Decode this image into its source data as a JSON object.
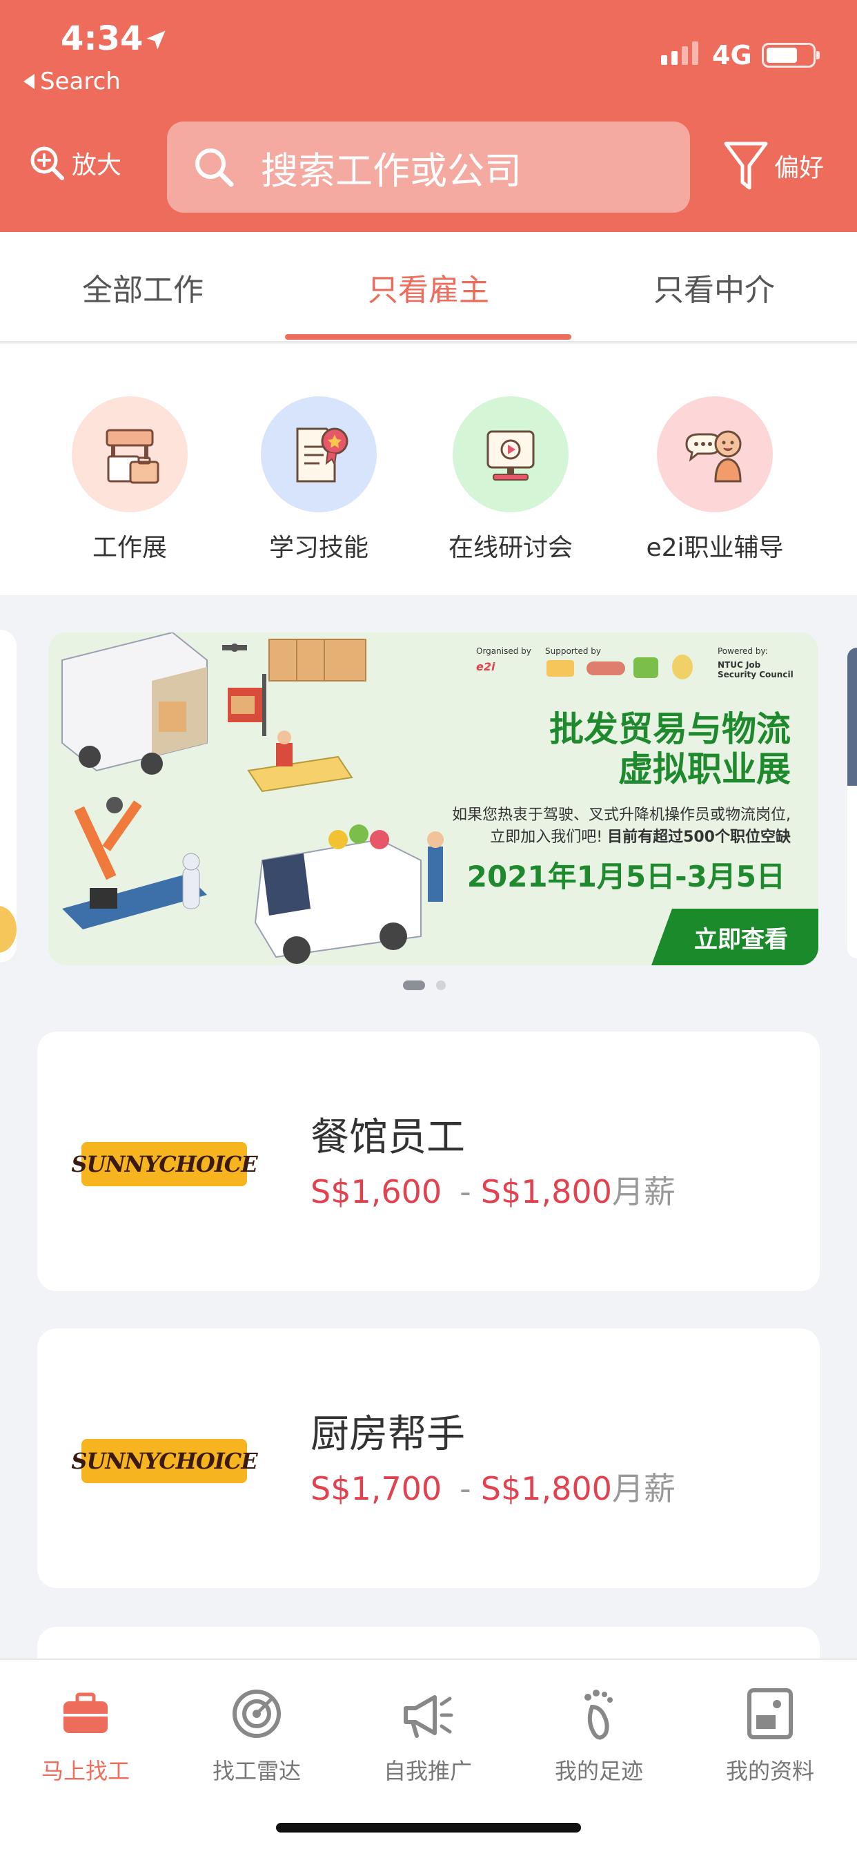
{
  "status_bar": {
    "time": "4:34",
    "back_label": "Search",
    "network": "4G"
  },
  "header": {
    "zoom_label": "放大",
    "search_placeholder": "搜索工作或公司",
    "preference_label": "偏好",
    "accent_color": "#ee6c5c"
  },
  "tabs": [
    {
      "label": "全部工作",
      "active": false
    },
    {
      "label": "只看雇主",
      "active": true
    },
    {
      "label": "只看中介",
      "active": false
    }
  ],
  "categories": [
    {
      "label": "工作展",
      "icon": "job-fair-icon"
    },
    {
      "label": "学习技能",
      "icon": "learn-skill-icon"
    },
    {
      "label": "在线研讨会",
      "icon": "webinar-icon"
    },
    {
      "label": "e2i职业辅导",
      "icon": "career-coaching-icon"
    }
  ],
  "banner": {
    "organised_by": "Organised by",
    "supported_by": "Supported by",
    "powered_by": "Powered by:",
    "ntuc": "NTUC Job Security Council",
    "title_line1": "批发贸易与物流",
    "title_line2": "虚拟职业展",
    "desc_line1": "如果您热衷于驾驶、叉式升降机操作员或物流岗位,",
    "desc_line2_a": "立即加入我们吧!",
    "desc_line2_b": "目前有超过500个职位空缺",
    "date": "2021年1月5日-3月5日",
    "cta": "立即查看",
    "slide_index": 1,
    "slide_count": 2
  },
  "jobs": [
    {
      "company_logo_text": "SUNNYCHOICE",
      "title": "餐馆员工",
      "salary_min": "S$1,600",
      "salary_max": "S$1,800",
      "salary_unit": "月薪"
    },
    {
      "company_logo_text": "SUNNYCHOICE",
      "title": "厨房帮手",
      "salary_min": "S$1,700",
      "salary_max": "S$1,800",
      "salary_unit": "月薪"
    }
  ],
  "salary_separator": "-",
  "bottom_nav": [
    {
      "label": "马上找工",
      "icon": "briefcase-icon",
      "active": true
    },
    {
      "label": "找工雷达",
      "icon": "target-icon",
      "active": false
    },
    {
      "label": "自我推广",
      "icon": "megaphone-icon",
      "active": false
    },
    {
      "label": "我的足迹",
      "icon": "footprint-icon",
      "active": false
    },
    {
      "label": "我的资料",
      "icon": "profile-card-icon",
      "active": false
    }
  ]
}
